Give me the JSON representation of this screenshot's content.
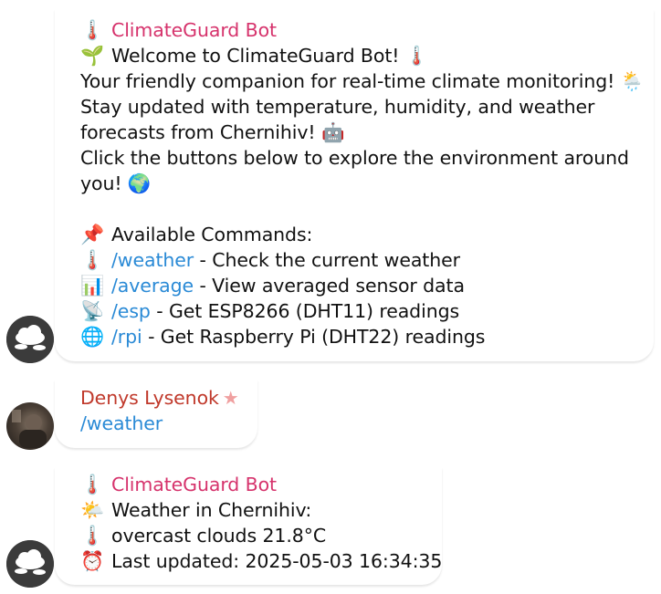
{
  "messages": [
    {
      "sender": "ClimateGuard Bot",
      "sender_icon": "thermometer-icon",
      "welcome": "Welcome to ClimateGuard Bot!",
      "intro_1": "Your friendly companion for real-time climate monitoring!",
      "intro_2": "Stay updated with temperature, humidity, and weather",
      "intro_3": "forecasts from Chernihiv!",
      "intro_4": "Click the buttons below to explore the environment around",
      "intro_5": "you!",
      "commands_title": "Available Commands:",
      "commands": [
        {
          "cmd": "/weather",
          "desc": " - Check the current weather",
          "icon": "thermometer-icon"
        },
        {
          "cmd": "/average",
          "desc": " - View averaged sensor data",
          "icon": "bar-chart-icon"
        },
        {
          "cmd": "/esp",
          "desc": " - Get ESP8266 (DHT11) readings",
          "icon": "satellite-icon"
        },
        {
          "cmd": "/rpi",
          "desc": " - Get Raspberry Pi (DHT22) readings",
          "icon": "globe-icon"
        }
      ]
    },
    {
      "sender": "Denys Lysenok",
      "text": "/weather"
    },
    {
      "sender": "ClimateGuard Bot",
      "title": "Weather in Chernihiv:",
      "condition": "overcast clouds 21.8°C",
      "updated": "Last updated: 2025-05-03 16:34:35"
    }
  ],
  "colors": {
    "bot_name": "#d6336c",
    "user_name": "#c0392b",
    "command_link": "#2a8ad6"
  }
}
